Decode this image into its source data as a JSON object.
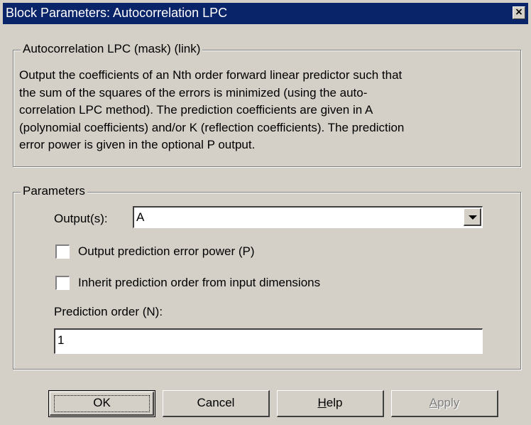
{
  "window": {
    "title": "Block Parameters: Autocorrelation LPC",
    "close_glyph": "×"
  },
  "mask": {
    "legend": "Autocorrelation LPC (mask) (link)",
    "description": [
      "Output the coefficients of an Nth order forward linear predictor such that",
      "the sum of the squares of the errors is minimized (using the auto-",
      "correlation LPC method).  The prediction coefficients are given in A",
      "(polynomial coefficients) and/or K (reflection coefficients).  The prediction",
      "error power is given in the optional P output."
    ]
  },
  "parameters": {
    "legend": "Parameters",
    "outputs_label": "Output(s):",
    "outputs_value": "A",
    "chk_error_power": {
      "label": "Output prediction error power (P)",
      "checked": false
    },
    "chk_inherit_order": {
      "label": "Inherit prediction order from input dimensions",
      "checked": false
    },
    "order_label": "Prediction order (N):",
    "order_value": "1"
  },
  "buttons": {
    "ok": "OK",
    "cancel": "Cancel",
    "help": "Help",
    "apply": "Apply",
    "apply_enabled": false
  },
  "colors": {
    "titlebar": "#0a246a",
    "face": "#d4d0c8"
  }
}
